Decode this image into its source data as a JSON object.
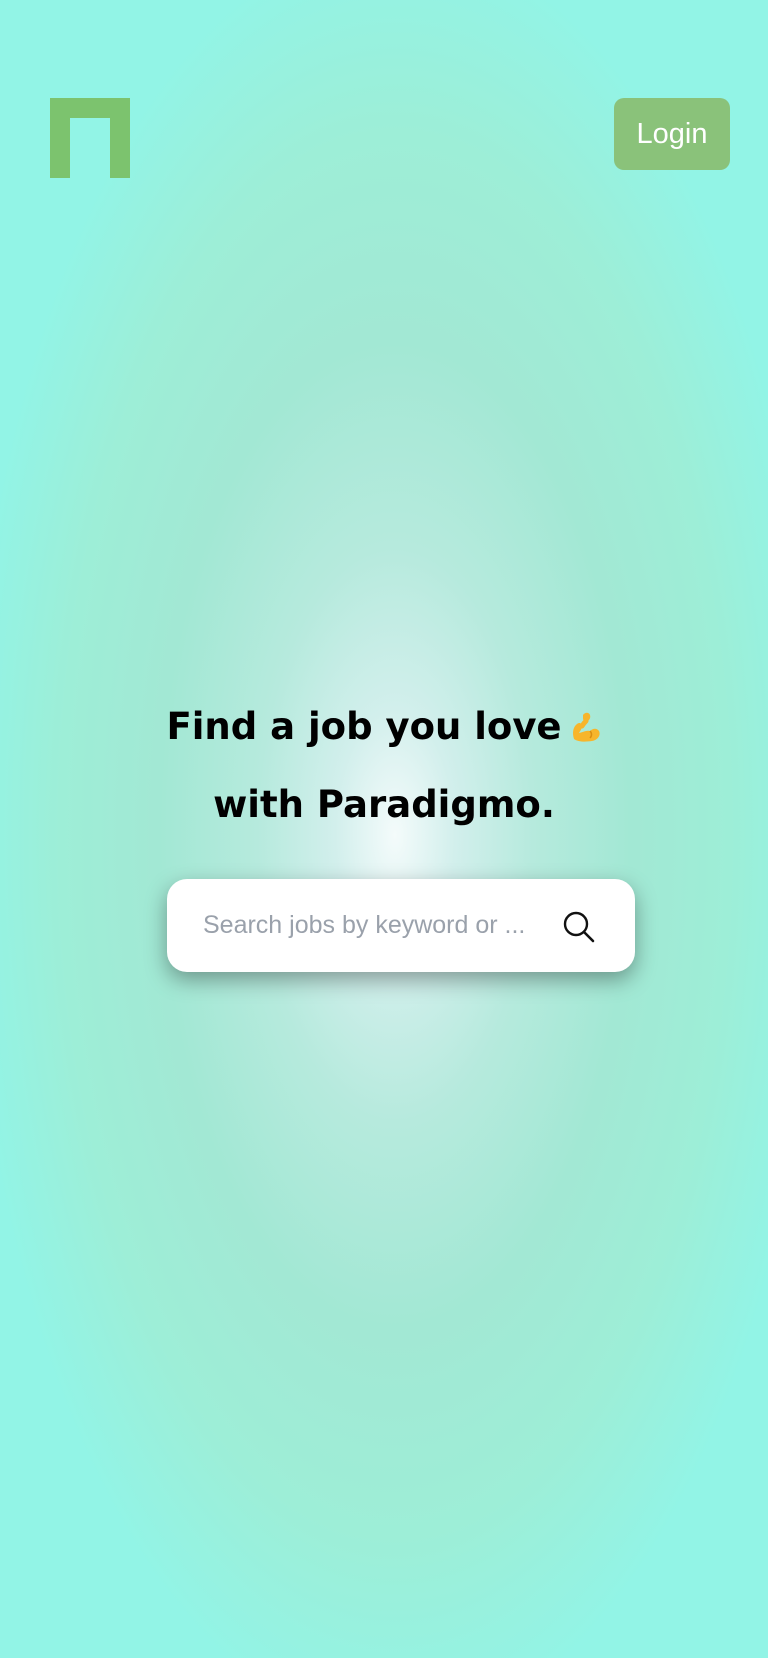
{
  "header": {
    "logo_icon": "arch-logo-icon",
    "login_label": "Login"
  },
  "hero": {
    "line1": "Find a job you love",
    "emoji_icon": "flexed-biceps-icon",
    "line2": "with Paradigmo."
  },
  "search": {
    "placeholder": "Search jobs by keyword or ...",
    "icon": "search-icon"
  },
  "colors": {
    "brand_green": "#8ac27a",
    "logo_green": "#7cc36e",
    "background_teal": "#92f4e6"
  }
}
